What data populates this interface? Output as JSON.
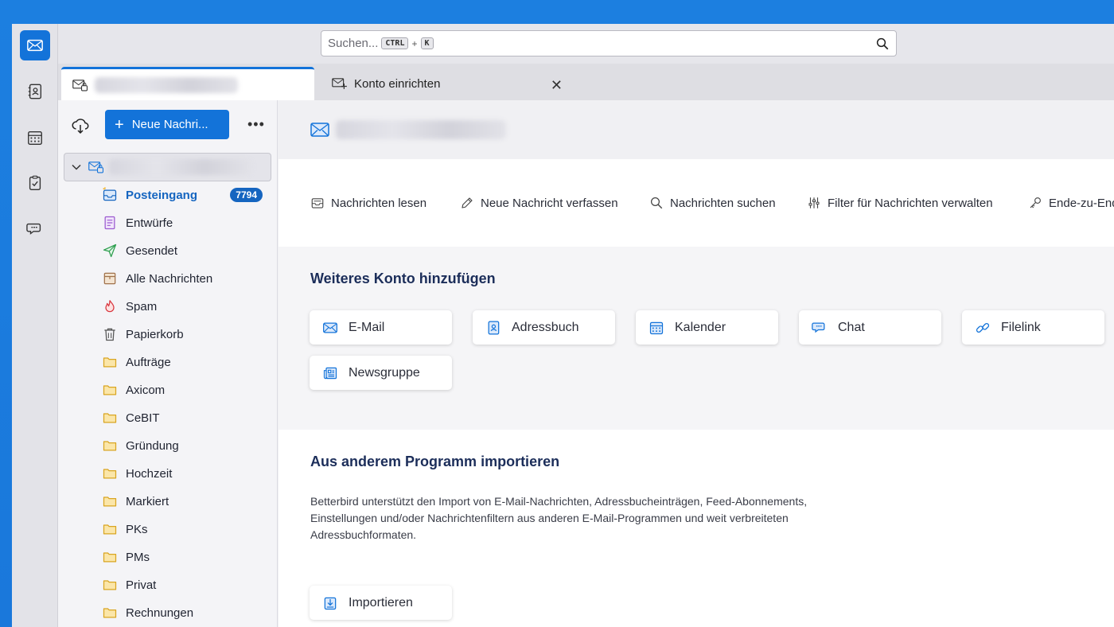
{
  "search": {
    "placeholder": "Suchen...",
    "key1": "CTRL",
    "plus": "+",
    "key2": "K"
  },
  "tabs": {
    "second_label": "Konto einrichten"
  },
  "folderpane": {
    "new_message_label": "Neue Nachri...",
    "more_label": "•••",
    "folders": [
      {
        "label": "Posteingang",
        "badge": "7794"
      },
      {
        "label": "Entwürfe"
      },
      {
        "label": "Gesendet"
      },
      {
        "label": "Alle Nachrichten"
      },
      {
        "label": "Spam"
      },
      {
        "label": "Papierkorb"
      },
      {
        "label": "Aufträge"
      },
      {
        "label": "Axicom"
      },
      {
        "label": "CeBIT"
      },
      {
        "label": "Gründung"
      },
      {
        "label": "Hochzeit"
      },
      {
        "label": "Markiert"
      },
      {
        "label": "PKs"
      },
      {
        "label": "PMs"
      },
      {
        "label": "Privat"
      },
      {
        "label": "Rechnungen"
      }
    ]
  },
  "main": {
    "actions": [
      {
        "label": "Nachrichten lesen",
        "icon": "read-messages-icon"
      },
      {
        "label": "Neue Nachricht verfassen",
        "icon": "pencil-icon"
      },
      {
        "label": "Nachrichten suchen",
        "icon": "search-icon"
      },
      {
        "label": "Filter für Nachrichten verwalten",
        "icon": "filter-icon"
      },
      {
        "label": "Ende-zu-End",
        "icon": "key-icon"
      }
    ],
    "add_title": "Weiteres Konto hinzufügen",
    "add_cards": [
      {
        "label": "E-Mail",
        "icon": "mail-icon"
      },
      {
        "label": "Adressbuch",
        "icon": "address-book-icon"
      },
      {
        "label": "Kalender",
        "icon": "calendar-icon"
      },
      {
        "label": "Chat",
        "icon": "chat-icon"
      },
      {
        "label": "Filelink",
        "icon": "link-icon"
      },
      {
        "label": "Newsgruppe",
        "icon": "newsgroup-icon"
      }
    ],
    "import_title": "Aus anderem Programm importieren",
    "import_text": "Betterbird unterstützt den Import von E-Mail-Nachrichten, Adressbucheinträgen, Feed-Abonnements, Einstellungen und/oder Nachrichtenfiltern aus anderen E-Mail-Programmen und weit verbreiteten Adressbuchformaten.",
    "import_button": "Importieren"
  },
  "colors": {
    "accent": "#1373d9",
    "badge": "#1565c0",
    "section_title": "#1c2e5a",
    "desktop": "#1a78db"
  }
}
